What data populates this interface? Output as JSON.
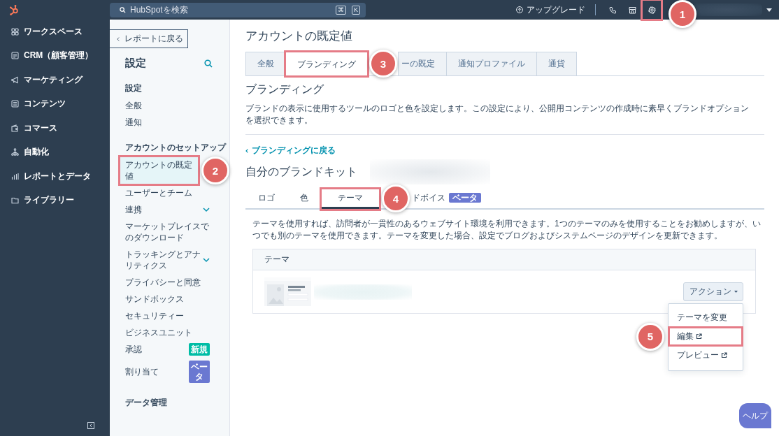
{
  "nav": {
    "items": [
      {
        "label": "ワークスペース"
      },
      {
        "label": "CRM（顧客管理）"
      },
      {
        "label": "マーケティング"
      },
      {
        "label": "コンテンツ"
      },
      {
        "label": "コマース"
      },
      {
        "label": "自動化"
      },
      {
        "label": "レポートとデータ"
      },
      {
        "label": "ライブラリー"
      }
    ]
  },
  "top_bar": {
    "search": {
      "placeholder": "HubSpotを検索",
      "shortcut": [
        "⌘",
        "K"
      ]
    },
    "upgrade": "アップグレード",
    "settings": {
      "highlighted": true,
      "callout": "1"
    }
  },
  "settings_sidebar": {
    "back": "レポートに戻る",
    "title": "設定",
    "sections": [
      {
        "heading": "設定",
        "items": [
          {
            "label": "全般",
            "selected": false,
            "highlighted": false
          },
          {
            "label": "通知",
            "selected": false,
            "highlighted": false
          }
        ]
      },
      {
        "heading": "アカウントのセットアップ",
        "items": [
          {
            "label": "アカウントの既定値",
            "selected": true,
            "highlighted": true,
            "callout": "2"
          },
          {
            "label": "ユーザーとチーム",
            "selected": false,
            "highlighted": false
          },
          {
            "label": "連携",
            "selected": false,
            "highlighted": false,
            "expanded": false
          },
          {
            "label": "マーケットプレイスでのダウンロード",
            "selected": false,
            "highlighted": false
          },
          {
            "label": "トラッキングとアナリティクス",
            "selected": false,
            "highlighted": false,
            "expanded": false
          },
          {
            "label": "プライバシーと同意",
            "selected": false,
            "highlighted": false
          },
          {
            "label": "サンドボックス",
            "selected": false,
            "highlighted": false
          },
          {
            "label": "セキュリティー",
            "selected": false,
            "highlighted": false
          },
          {
            "label": "ビジネスユニット",
            "selected": false,
            "highlighted": false
          },
          {
            "label": "承認",
            "selected": false,
            "highlighted": false,
            "badge": {
              "text": "新規",
              "color": "#00bda5"
            }
          },
          {
            "label": "割り当て",
            "selected": false,
            "highlighted": false,
            "badge": {
              "text": "ベータ",
              "color": "#6a78d1"
            }
          }
        ]
      },
      {
        "heading": "データ管理"
      }
    ]
  },
  "page": {
    "title": "アカウントの既定値",
    "tabs": [
      {
        "label": "全般",
        "selected": false,
        "highlighted": false
      },
      {
        "label": "ブランディング",
        "selected": true,
        "highlighted": true,
        "callout": "3"
      },
      {
        "label": "ーの既定",
        "selected": false,
        "highlighted": false
      },
      {
        "label": "通知プロファイル",
        "selected": false,
        "highlighted": false
      },
      {
        "label": "通貨",
        "selected": false,
        "highlighted": false
      }
    ],
    "section_title": "ブランディング",
    "description": "ブランドの表示に使用するツールのロゴと色を設定します。この設定により、公開用コンテンツの作成時に素早くブランドオプションを選択できます。",
    "back_link": "ブランディングに戻る",
    "kit_title": "自分のブランドキット",
    "subtabs": [
      {
        "label": "ロゴ",
        "selected": false,
        "highlighted": false
      },
      {
        "label": "色",
        "selected": false,
        "highlighted": false
      },
      {
        "label": "テーマ",
        "selected": true,
        "highlighted": true,
        "callout": "4"
      },
      {
        "label": "ドボイス",
        "selected": false,
        "highlighted": false,
        "badge": {
          "text": "ベータ",
          "color": "#6a78d1"
        }
      }
    ],
    "theme_description": "テーマを使用すれば、訪問者が一貫性のあるウェブサイト環境を利用できます。1つのテーマのみを使用することをお勧めしますが、いつでも別のテーマを使用できます。テーマを変更した場合、設定でブログおよびシステムページのデザインを更新できます。",
    "theme_card": {
      "header": "テーマ",
      "action_button": "アクション",
      "menu": [
        {
          "label": "テーマを変更",
          "external": false,
          "highlighted": false
        },
        {
          "label": "編集",
          "external": true,
          "highlighted": true,
          "callout": "5"
        },
        {
          "label": "プレビュー",
          "external": true,
          "highlighted": false
        }
      ]
    }
  },
  "help_button": "ヘルプ"
}
